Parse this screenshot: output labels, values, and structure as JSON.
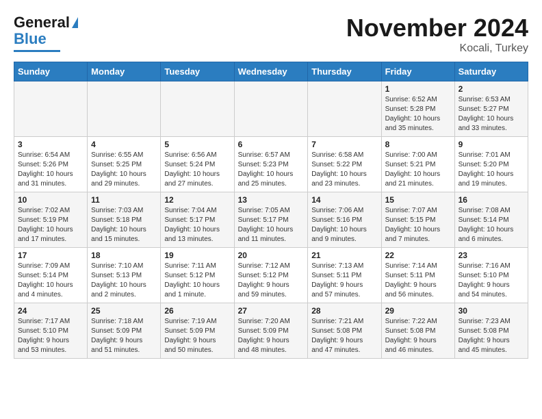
{
  "header": {
    "logo_line1": "General",
    "logo_line2": "Blue",
    "month": "November 2024",
    "location": "Kocali, Turkey"
  },
  "days_of_week": [
    "Sunday",
    "Monday",
    "Tuesday",
    "Wednesday",
    "Thursday",
    "Friday",
    "Saturday"
  ],
  "weeks": [
    [
      {
        "day": "",
        "info": ""
      },
      {
        "day": "",
        "info": ""
      },
      {
        "day": "",
        "info": ""
      },
      {
        "day": "",
        "info": ""
      },
      {
        "day": "",
        "info": ""
      },
      {
        "day": "1",
        "info": "Sunrise: 6:52 AM\nSunset: 5:28 PM\nDaylight: 10 hours\nand 35 minutes."
      },
      {
        "day": "2",
        "info": "Sunrise: 6:53 AM\nSunset: 5:27 PM\nDaylight: 10 hours\nand 33 minutes."
      }
    ],
    [
      {
        "day": "3",
        "info": "Sunrise: 6:54 AM\nSunset: 5:26 PM\nDaylight: 10 hours\nand 31 minutes."
      },
      {
        "day": "4",
        "info": "Sunrise: 6:55 AM\nSunset: 5:25 PM\nDaylight: 10 hours\nand 29 minutes."
      },
      {
        "day": "5",
        "info": "Sunrise: 6:56 AM\nSunset: 5:24 PM\nDaylight: 10 hours\nand 27 minutes."
      },
      {
        "day": "6",
        "info": "Sunrise: 6:57 AM\nSunset: 5:23 PM\nDaylight: 10 hours\nand 25 minutes."
      },
      {
        "day": "7",
        "info": "Sunrise: 6:58 AM\nSunset: 5:22 PM\nDaylight: 10 hours\nand 23 minutes."
      },
      {
        "day": "8",
        "info": "Sunrise: 7:00 AM\nSunset: 5:21 PM\nDaylight: 10 hours\nand 21 minutes."
      },
      {
        "day": "9",
        "info": "Sunrise: 7:01 AM\nSunset: 5:20 PM\nDaylight: 10 hours\nand 19 minutes."
      }
    ],
    [
      {
        "day": "10",
        "info": "Sunrise: 7:02 AM\nSunset: 5:19 PM\nDaylight: 10 hours\nand 17 minutes."
      },
      {
        "day": "11",
        "info": "Sunrise: 7:03 AM\nSunset: 5:18 PM\nDaylight: 10 hours\nand 15 minutes."
      },
      {
        "day": "12",
        "info": "Sunrise: 7:04 AM\nSunset: 5:17 PM\nDaylight: 10 hours\nand 13 minutes."
      },
      {
        "day": "13",
        "info": "Sunrise: 7:05 AM\nSunset: 5:17 PM\nDaylight: 10 hours\nand 11 minutes."
      },
      {
        "day": "14",
        "info": "Sunrise: 7:06 AM\nSunset: 5:16 PM\nDaylight: 10 hours\nand 9 minutes."
      },
      {
        "day": "15",
        "info": "Sunrise: 7:07 AM\nSunset: 5:15 PM\nDaylight: 10 hours\nand 7 minutes."
      },
      {
        "day": "16",
        "info": "Sunrise: 7:08 AM\nSunset: 5:14 PM\nDaylight: 10 hours\nand 6 minutes."
      }
    ],
    [
      {
        "day": "17",
        "info": "Sunrise: 7:09 AM\nSunset: 5:14 PM\nDaylight: 10 hours\nand 4 minutes."
      },
      {
        "day": "18",
        "info": "Sunrise: 7:10 AM\nSunset: 5:13 PM\nDaylight: 10 hours\nand 2 minutes."
      },
      {
        "day": "19",
        "info": "Sunrise: 7:11 AM\nSunset: 5:12 PM\nDaylight: 10 hours\nand 1 minute."
      },
      {
        "day": "20",
        "info": "Sunrise: 7:12 AM\nSunset: 5:12 PM\nDaylight: 9 hours\nand 59 minutes."
      },
      {
        "day": "21",
        "info": "Sunrise: 7:13 AM\nSunset: 5:11 PM\nDaylight: 9 hours\nand 57 minutes."
      },
      {
        "day": "22",
        "info": "Sunrise: 7:14 AM\nSunset: 5:11 PM\nDaylight: 9 hours\nand 56 minutes."
      },
      {
        "day": "23",
        "info": "Sunrise: 7:16 AM\nSunset: 5:10 PM\nDaylight: 9 hours\nand 54 minutes."
      }
    ],
    [
      {
        "day": "24",
        "info": "Sunrise: 7:17 AM\nSunset: 5:10 PM\nDaylight: 9 hours\nand 53 minutes."
      },
      {
        "day": "25",
        "info": "Sunrise: 7:18 AM\nSunset: 5:09 PM\nDaylight: 9 hours\nand 51 minutes."
      },
      {
        "day": "26",
        "info": "Sunrise: 7:19 AM\nSunset: 5:09 PM\nDaylight: 9 hours\nand 50 minutes."
      },
      {
        "day": "27",
        "info": "Sunrise: 7:20 AM\nSunset: 5:09 PM\nDaylight: 9 hours\nand 48 minutes."
      },
      {
        "day": "28",
        "info": "Sunrise: 7:21 AM\nSunset: 5:08 PM\nDaylight: 9 hours\nand 47 minutes."
      },
      {
        "day": "29",
        "info": "Sunrise: 7:22 AM\nSunset: 5:08 PM\nDaylight: 9 hours\nand 46 minutes."
      },
      {
        "day": "30",
        "info": "Sunrise: 7:23 AM\nSunset: 5:08 PM\nDaylight: 9 hours\nand 45 minutes."
      }
    ]
  ]
}
